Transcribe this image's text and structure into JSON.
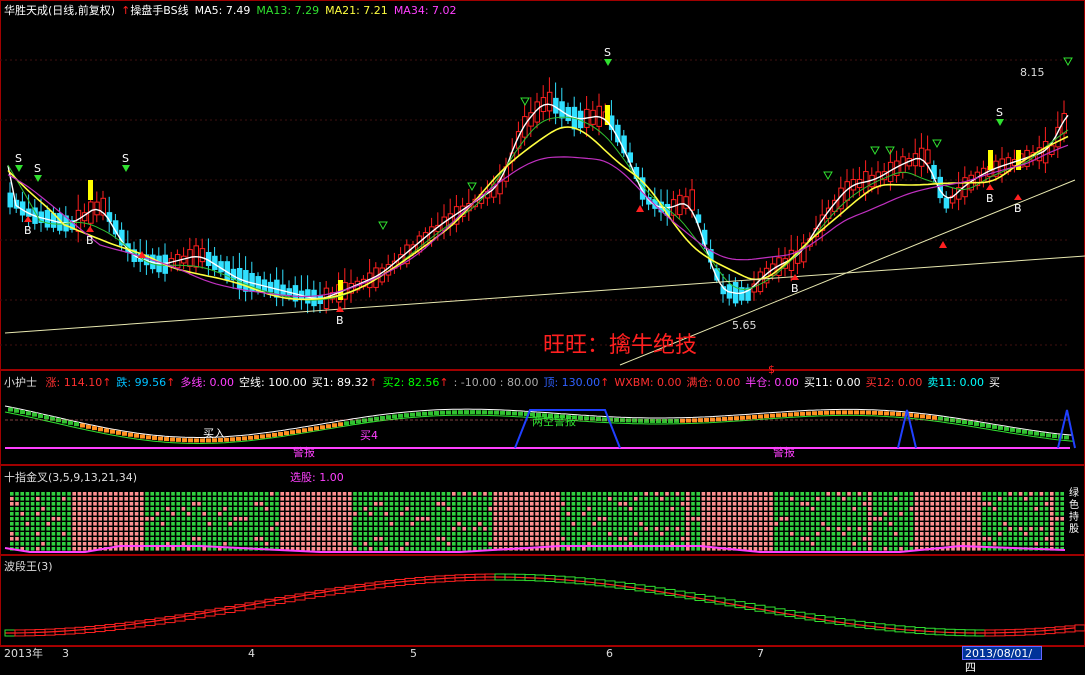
{
  "header": {
    "stock": "华胜天成(日线,前复权)",
    "indicator_arrow": "↑",
    "indicator": "操盘手BS线",
    "ma5": "MA5: 7.49",
    "ma13": "MA13: 7.29",
    "ma21": "MA21: 7.21",
    "ma34": "MA34: 7.02"
  },
  "main_chart": {
    "price_high": "8.15",
    "price_low": "5.65",
    "watermark": "旺旺：擒牛绝技",
    "buy_label": "B",
    "sell_label": "S"
  },
  "panel2": {
    "name": "小护士",
    "items": [
      {
        "label": "涨: 114.10",
        "arrow": "↑",
        "color": "#ff3030"
      },
      {
        "label": "跌: 99.56",
        "arrow": "↑",
        "color": "#00c0ff"
      },
      {
        "label": "多线: 0.00",
        "arrow": "",
        "color": "#ff40ff"
      },
      {
        "label": "空线: 100.00",
        "arrow": "",
        "color": "#ffffff"
      },
      {
        "label": "买1: 89.32",
        "arrow": "↑",
        "color": "#ffffff"
      },
      {
        "label": "买2: 82.56",
        "arrow": "↑",
        "color": "#00ff00"
      },
      {
        "label": ": -10.00 : 80.00",
        "arrow": "",
        "color": "#aaaaaa"
      },
      {
        "label": "顶: 130.00",
        "arrow": "↑",
        "color": "#3060ff"
      },
      {
        "label": "WXBM: 0.00",
        "arrow": "",
        "color": "#ff3030"
      },
      {
        "label": "满仓: 0.00",
        "arrow": "",
        "color": "#ff3030"
      },
      {
        "label": "半仓: 0.00",
        "arrow": "",
        "color": "#ff40ff"
      },
      {
        "label": "买11: 0.00",
        "arrow": "",
        "color": "#ffffff"
      },
      {
        "label": "买12: 0.00",
        "arrow": "",
        "color": "#ff3030"
      },
      {
        "label": "卖11: 0.00",
        "arrow": "",
        "color": "#00ffff"
      },
      {
        "label": "买",
        "arrow": "",
        "color": "#ffffff"
      }
    ],
    "annotations": {
      "buy_in": "买入",
      "tag_a": "买4",
      "tag_b": "两空警报",
      "tag_c": "警报",
      "tag_d": "警报"
    }
  },
  "panel3": {
    "name": "十指金叉(3,5,9,13,21,34)",
    "select": "选股: 1.00",
    "side_text": "绿色持股"
  },
  "panel4": {
    "name": "波段王(3)"
  },
  "date_axis": {
    "year": "2013年",
    "m3": "3",
    "m4": "4",
    "m5": "5",
    "m6": "6",
    "m7": "7",
    "selected_date": "2013/08/01/四"
  },
  "colors": {
    "up": "#ff2020",
    "down": "#30e0ff",
    "ma5": "#ffffff",
    "ma13": "#30c030",
    "ma21": "#ffff40",
    "ma34": "#c030c0",
    "watermark": "#ff2020"
  }
}
